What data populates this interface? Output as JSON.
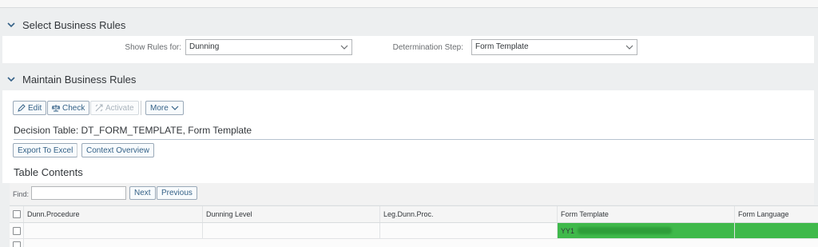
{
  "sections": {
    "select": {
      "title": "Select Business Rules"
    },
    "maintain": {
      "title": "Maintain Business Rules"
    }
  },
  "filters": {
    "show_rules_label": "Show Rules for:",
    "show_rules_value": "Dunning",
    "determination_label": "Determination Step:",
    "determination_value": "Form Template"
  },
  "toolbar": {
    "edit": "Edit",
    "check": "Check",
    "activate": "Activate",
    "more": "More"
  },
  "decision_table": {
    "title": "Decision Table: DT_FORM_TEMPLATE, Form Template",
    "export_button": "Export To Excel",
    "context_button": "Context Overview"
  },
  "table_contents": {
    "title": "Table Contents",
    "find_label": "Find:",
    "find_value": "",
    "next": "Next",
    "previous": "Previous",
    "columns": [
      "Dunn.Procedure",
      "Dunning Level",
      "Leg.Dunn.Proc.",
      "Form Template",
      "Form Language"
    ],
    "rows": [
      {
        "dunn_procedure": "",
        "dunning_level": "",
        "leg_dunn_proc": "",
        "form_template": "YY1",
        "form_language": ""
      }
    ]
  },
  "colors": {
    "accent": "#346187",
    "highlight_green": "#3fb94b",
    "background": "#edeff0"
  }
}
